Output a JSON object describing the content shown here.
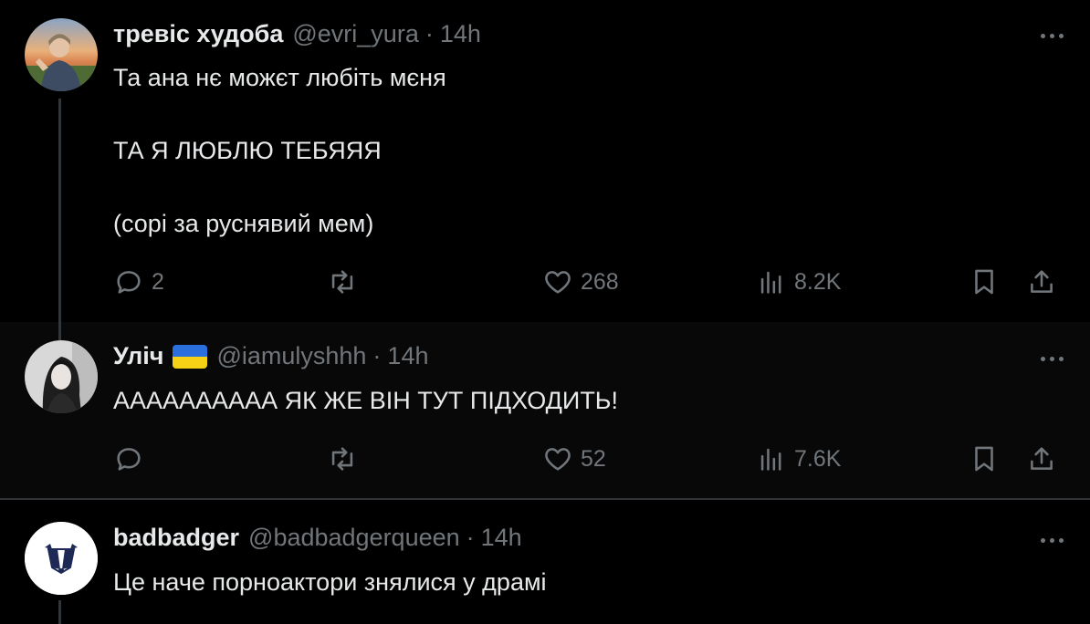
{
  "colors": {
    "background": "#000000",
    "text": "#e7e9ea",
    "muted": "#71767b",
    "flag_blue": "#2a6fdb",
    "flag_yellow": "#f7d116"
  },
  "tweets": [
    {
      "name": "тревіс худоба",
      "handle": "@evri_yura",
      "dot": "·",
      "time": "14h",
      "text": "Та ана нє можєт любіть мєня\n\nТА Я ЛЮБЛЮ ТЕБЯЯЯ\n\n(сорі за руснявий мем)",
      "replies": "2",
      "reposts": "",
      "likes": "268",
      "views": "8.2K"
    },
    {
      "name": "Уліч",
      "flag": "ukraine-flag",
      "handle": "@iamulyshhh",
      "dot": "·",
      "time": "14h",
      "text": "АААААААААА ЯК ЖЕ ВІН ТУТ ПІДХОДИТЬ!",
      "replies": "",
      "reposts": "",
      "likes": "52",
      "views": "7.6K"
    },
    {
      "name": "badbadger",
      "handle": "@badbadgerqueen",
      "dot": "·",
      "time": "14h",
      "text": "Це наче порноактори знялися у драмі"
    }
  ]
}
